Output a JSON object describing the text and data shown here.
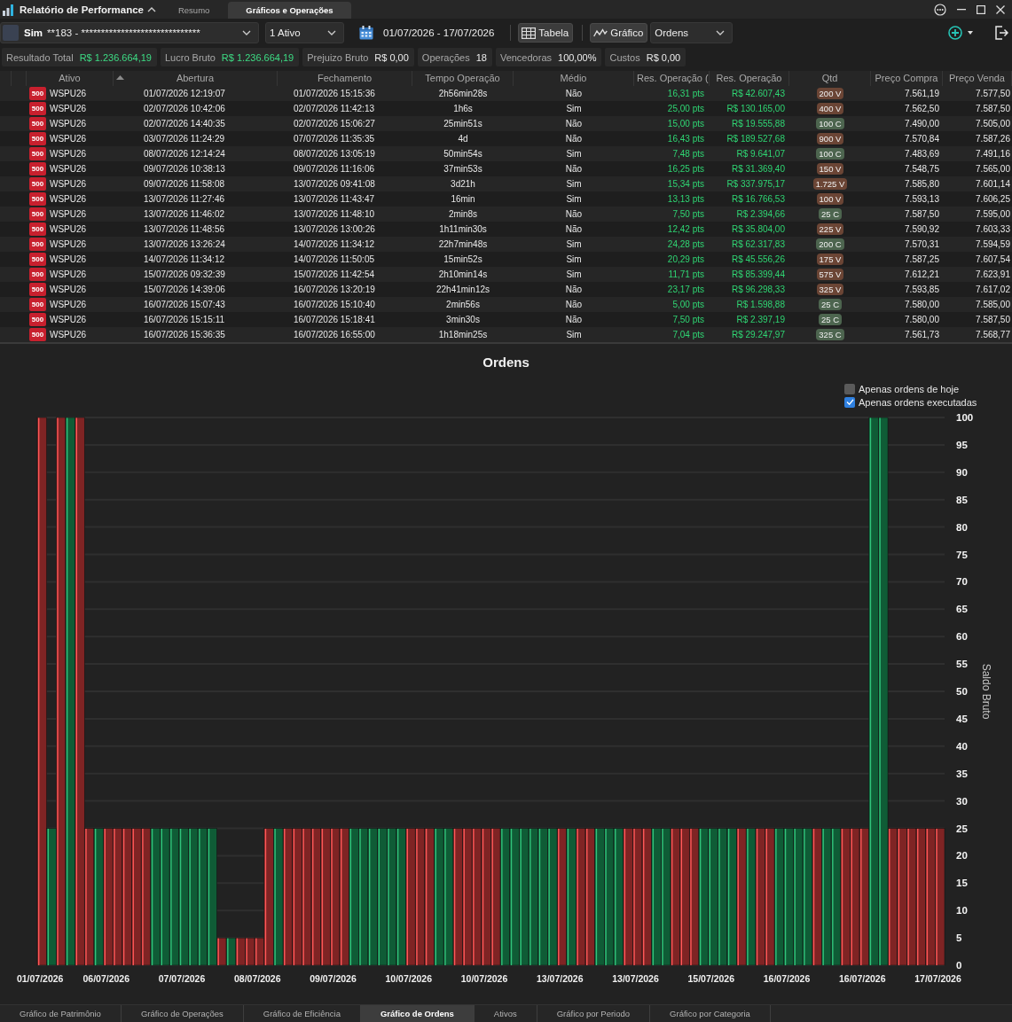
{
  "window": {
    "title": "Relatório de Performance",
    "tabs": [
      {
        "label": "Resumo",
        "selected": false
      },
      {
        "label": "Gráficos e Operações",
        "selected": true
      }
    ]
  },
  "toolbar": {
    "account": {
      "label": "Sim",
      "value": "**183 - ******************************"
    },
    "asset_select": {
      "value": "1 Ativo"
    },
    "date_range": "01/07/2026 - 17/07/2026",
    "view_toggles": [
      {
        "label": "Tabela",
        "on": true
      },
      {
        "label": "Gráfico",
        "on": true
      }
    ],
    "chart_select": {
      "value": "Ordens"
    }
  },
  "summary": [
    {
      "label": "Resultado Total",
      "value": "R$ 1.236.664,19",
      "kind": "gain"
    },
    {
      "label": "Lucro Bruto",
      "value": "R$ 1.236.664,19",
      "kind": "gain"
    },
    {
      "label": "Prejuizo Bruto",
      "value": "R$ 0,00",
      "kind": "plain"
    },
    {
      "label": "Operações",
      "value": "18",
      "kind": "plain"
    },
    {
      "label": "Vencedoras",
      "value": "100,00%",
      "kind": "plain"
    },
    {
      "label": "Custos",
      "value": "R$ 0,00",
      "kind": "plain"
    }
  ],
  "table": {
    "columns": [
      {
        "label": "Ativo",
        "sorted": false
      },
      {
        "label": "Abertura",
        "sorted": true
      },
      {
        "label": "Fechamento",
        "sorted": false
      },
      {
        "label": "Tempo Operação",
        "sorted": false
      },
      {
        "label": "Médio",
        "sorted": false
      },
      {
        "label": "Res. Operação (",
        "sorted": false
      },
      {
        "label": "Res. Operação",
        "sorted": false
      },
      {
        "label": "Qtd",
        "sorted": false
      },
      {
        "label": "Preço Compra",
        "sorted": false
      },
      {
        "label": "Preço Venda",
        "sorted": false
      }
    ],
    "rows": [
      {
        "badge": "500",
        "ativo": "WSPU26",
        "abertura": "01/07/2026 12:19:07",
        "fechamento": "01/07/2026 15:15:36",
        "tempo": "2h56min28s",
        "medio": "Não",
        "res_pts": "16,31 pts",
        "res_brl": "R$ 42.607,43",
        "qtd": {
          "text": "200 V",
          "color": "#6b4535"
        },
        "compra": "7.561,19",
        "venda": "7.577,50"
      },
      {
        "badge": "500",
        "ativo": "WSPU26",
        "abertura": "02/07/2026 10:42:06",
        "fechamento": "02/07/2026 11:42:13",
        "tempo": "1h6s",
        "medio": "Sim",
        "res_pts": "25,00 pts",
        "res_brl": "R$ 130.165,00",
        "qtd": {
          "text": "400 V",
          "color": "#6b4535"
        },
        "compra": "7.562,50",
        "venda": "7.587,50"
      },
      {
        "badge": "500",
        "ativo": "WSPU26",
        "abertura": "02/07/2026 14:40:35",
        "fechamento": "02/07/2026 15:06:27",
        "tempo": "25min51s",
        "medio": "Não",
        "res_pts": "15,00 pts",
        "res_brl": "R$ 19.555,88",
        "qtd": {
          "text": "100 C",
          "color": "#4d654f"
        },
        "compra": "7.490,00",
        "venda": "7.505,00"
      },
      {
        "badge": "500",
        "ativo": "WSPU26",
        "abertura": "03/07/2026 11:24:29",
        "fechamento": "07/07/2026 11:35:35",
        "tempo": "4d",
        "medio": "Não",
        "res_pts": "16,43 pts",
        "res_brl": "R$ 189.527,68",
        "qtd": {
          "text": "900 V",
          "color": "#6b4535"
        },
        "compra": "7.570,84",
        "venda": "7.587,26"
      },
      {
        "badge": "500",
        "ativo": "WSPU26",
        "abertura": "08/07/2026 12:14:24",
        "fechamento": "08/07/2026 13:05:19",
        "tempo": "50min54s",
        "medio": "Sim",
        "res_pts": "7,48 pts",
        "res_brl": "R$ 9.641,07",
        "qtd": {
          "text": "100 C",
          "color": "#4d654f"
        },
        "compra": "7.483,69",
        "venda": "7.491,16"
      },
      {
        "badge": "500",
        "ativo": "WSPU26",
        "abertura": "09/07/2026 10:38:13",
        "fechamento": "09/07/2026 11:16:06",
        "tempo": "37min53s",
        "medio": "Não",
        "res_pts": "16,25 pts",
        "res_brl": "R$ 31.369,40",
        "qtd": {
          "text": "150 V",
          "color": "#6b4535"
        },
        "compra": "7.548,75",
        "venda": "7.565,00"
      },
      {
        "badge": "500",
        "ativo": "WSPU26",
        "abertura": "09/07/2026 11:58:08",
        "fechamento": "13/07/2026 09:41:08",
        "tempo": "3d21h",
        "medio": "Sim",
        "res_pts": "15,34 pts",
        "res_brl": "R$ 337.975,17",
        "qtd": {
          "text": "1.725 V",
          "color": "#6b4535"
        },
        "compra": "7.585,80",
        "venda": "7.601,14"
      },
      {
        "badge": "500",
        "ativo": "WSPU26",
        "abertura": "13/07/2026 11:27:46",
        "fechamento": "13/07/2026 11:43:47",
        "tempo": "16min",
        "medio": "Sim",
        "res_pts": "13,13 pts",
        "res_brl": "R$ 16.766,53",
        "qtd": {
          "text": "100 V",
          "color": "#6b4535"
        },
        "compra": "7.593,13",
        "venda": "7.606,25"
      },
      {
        "badge": "500",
        "ativo": "WSPU26",
        "abertura": "13/07/2026 11:46:02",
        "fechamento": "13/07/2026 11:48:10",
        "tempo": "2min8s",
        "medio": "Não",
        "res_pts": "7,50 pts",
        "res_brl": "R$ 2.394,66",
        "qtd": {
          "text": "25 C",
          "color": "#4d654f"
        },
        "compra": "7.587,50",
        "venda": "7.595,00"
      },
      {
        "badge": "500",
        "ativo": "WSPU26",
        "abertura": "13/07/2026 11:48:56",
        "fechamento": "13/07/2026 13:00:26",
        "tempo": "1h11min30s",
        "medio": "Não",
        "res_pts": "12,42 pts",
        "res_brl": "R$ 35.804,00",
        "qtd": {
          "text": "225 V",
          "color": "#6b4535"
        },
        "compra": "7.590,92",
        "venda": "7.603,33"
      },
      {
        "badge": "500",
        "ativo": "WSPU26",
        "abertura": "13/07/2026 13:26:24",
        "fechamento": "14/07/2026 11:34:12",
        "tempo": "22h7min48s",
        "medio": "Sim",
        "res_pts": "24,28 pts",
        "res_brl": "R$ 62.317,83",
        "qtd": {
          "text": "200 C",
          "color": "#4d654f"
        },
        "compra": "7.570,31",
        "venda": "7.594,59"
      },
      {
        "badge": "500",
        "ativo": "WSPU26",
        "abertura": "14/07/2026 11:34:12",
        "fechamento": "14/07/2026 11:50:05",
        "tempo": "15min52s",
        "medio": "Sim",
        "res_pts": "20,29 pts",
        "res_brl": "R$ 45.556,26",
        "qtd": {
          "text": "175 V",
          "color": "#6b4535"
        },
        "compra": "7.587,25",
        "venda": "7.607,54"
      },
      {
        "badge": "500",
        "ativo": "WSPU26",
        "abertura": "15/07/2026 09:32:39",
        "fechamento": "15/07/2026 11:42:54",
        "tempo": "2h10min14s",
        "medio": "Sim",
        "res_pts": "11,71 pts",
        "res_brl": "R$ 85.399,44",
        "qtd": {
          "text": "575 V",
          "color": "#6b4535"
        },
        "compra": "7.612,21",
        "venda": "7.623,91"
      },
      {
        "badge": "500",
        "ativo": "WSPU26",
        "abertura": "15/07/2026 14:39:06",
        "fechamento": "16/07/2026 13:20:19",
        "tempo": "22h41min12s",
        "medio": "Não",
        "res_pts": "23,17 pts",
        "res_brl": "R$ 96.298,33",
        "qtd": {
          "text": "325 V",
          "color": "#6b4535"
        },
        "compra": "7.593,85",
        "venda": "7.617,02"
      },
      {
        "badge": "500",
        "ativo": "WSPU26",
        "abertura": "16/07/2026 15:07:43",
        "fechamento": "16/07/2026 15:10:40",
        "tempo": "2min56s",
        "medio": "Não",
        "res_pts": "5,00 pts",
        "res_brl": "R$ 1.598,88",
        "qtd": {
          "text": "25 C",
          "color": "#4d654f"
        },
        "compra": "7.580,00",
        "venda": "7.585,00"
      },
      {
        "badge": "500",
        "ativo": "WSPU26",
        "abertura": "16/07/2026 15:15:11",
        "fechamento": "16/07/2026 15:18:41",
        "tempo": "3min30s",
        "medio": "Não",
        "res_pts": "7,50 pts",
        "res_brl": "R$ 2.397,19",
        "qtd": {
          "text": "25 C",
          "color": "#4d654f"
        },
        "compra": "7.580,00",
        "venda": "7.587,50"
      },
      {
        "badge": "500",
        "ativo": "WSPU26",
        "abertura": "16/07/2026 15:36:35",
        "fechamento": "16/07/2026 16:55:00",
        "tempo": "1h18min25s",
        "medio": "Sim",
        "res_pts": "7,04 pts",
        "res_brl": "R$ 29.247,97",
        "qtd": {
          "text": "325 C",
          "color": "#4d654f"
        },
        "compra": "7.561,73",
        "venda": "7.568,77"
      }
    ]
  },
  "chart": {
    "checkboxes": [
      {
        "label": "Apenas ordens de hoje",
        "checked": false
      },
      {
        "label": "Apenas ordens executadas",
        "checked": true
      }
    ],
    "chart_data": {
      "type": "bar",
      "title": "Ordens",
      "ylabel": "Saldo Bruto",
      "grid": true,
      "ylim": [
        0,
        100
      ],
      "yticks": [
        0,
        5,
        10,
        15,
        20,
        25,
        30,
        35,
        40,
        45,
        50,
        55,
        60,
        65,
        70,
        75,
        80,
        85,
        90,
        95,
        100
      ],
      "categories": [
        "01/07/2026",
        null,
        null,
        null,
        null,
        null,
        null,
        "06/07/2026",
        null,
        null,
        null,
        null,
        null,
        null,
        null,
        "07/07/2026",
        null,
        null,
        null,
        null,
        null,
        null,
        null,
        "08/07/2026",
        null,
        null,
        null,
        null,
        null,
        null,
        null,
        "09/07/2026",
        null,
        null,
        null,
        null,
        null,
        null,
        null,
        "10/07/2026",
        null,
        null,
        null,
        null,
        null,
        null,
        null,
        "10/07/2026",
        null,
        null,
        null,
        null,
        null,
        null,
        null,
        "13/07/2026",
        null,
        null,
        null,
        null,
        null,
        null,
        null,
        "13/07/2026",
        null,
        null,
        null,
        null,
        null,
        null,
        null,
        "15/07/2026",
        null,
        null,
        null,
        null,
        null,
        null,
        null,
        "16/07/2026",
        null,
        null,
        null,
        null,
        null,
        null,
        null,
        "16/07/2026",
        null,
        null,
        null,
        null,
        null,
        null,
        null,
        "17/07/2026"
      ],
      "series": [
        {
          "color": "#7f2424",
          "values": [
            100,
            null,
            100,
            null,
            100,
            25,
            null,
            25,
            25,
            25,
            25,
            25,
            null,
            null,
            null,
            null,
            null,
            null,
            null,
            5,
            null,
            5,
            5,
            5,
            25,
            null,
            25,
            25,
            25,
            25,
            25,
            25,
            25,
            null,
            null,
            null,
            null,
            null,
            null,
            25,
            25,
            25,
            null,
            null,
            25,
            25,
            25,
            25,
            25,
            null,
            null,
            null,
            null,
            null,
            null,
            25,
            null,
            25,
            25,
            null,
            null,
            null,
            25,
            25,
            25,
            null,
            null,
            25,
            25,
            25,
            null,
            null,
            null,
            null,
            25,
            null,
            25,
            25,
            null,
            null,
            null,
            null,
            25,
            null,
            null,
            25,
            25,
            25,
            null,
            null,
            25,
            25,
            25,
            25,
            25,
            25
          ]
        },
        {
          "color": "#0f5c36",
          "values": [
            null,
            25,
            null,
            100,
            null,
            null,
            25,
            null,
            null,
            null,
            null,
            null,
            25,
            25,
            25,
            25,
            25,
            25,
            25,
            null,
            5,
            null,
            null,
            null,
            null,
            25,
            null,
            null,
            null,
            null,
            null,
            null,
            null,
            25,
            25,
            25,
            25,
            25,
            25,
            null,
            null,
            null,
            25,
            25,
            null,
            null,
            null,
            null,
            null,
            25,
            25,
            25,
            25,
            25,
            25,
            null,
            25,
            null,
            null,
            25,
            25,
            25,
            null,
            null,
            null,
            25,
            25,
            null,
            null,
            null,
            25,
            25,
            25,
            25,
            null,
            25,
            null,
            null,
            25,
            25,
            25,
            25,
            null,
            25,
            25,
            null,
            null,
            null,
            100,
            100,
            null,
            null,
            null,
            null,
            null,
            null
          ]
        }
      ]
    }
  },
  "bottom_tabs": [
    {
      "label": "Gráfico de Patrimônio",
      "selected": false
    },
    {
      "label": "Gráfico de Operações",
      "selected": false
    },
    {
      "label": "Gráfico de Eficiência",
      "selected": false
    },
    {
      "label": "Gráfico de Ordens",
      "selected": true
    },
    {
      "label": "Ativos",
      "selected": false
    },
    {
      "label": "Gráfico por Periodo",
      "selected": false
    },
    {
      "label": "Gráfico por Categoria",
      "selected": false
    }
  ]
}
